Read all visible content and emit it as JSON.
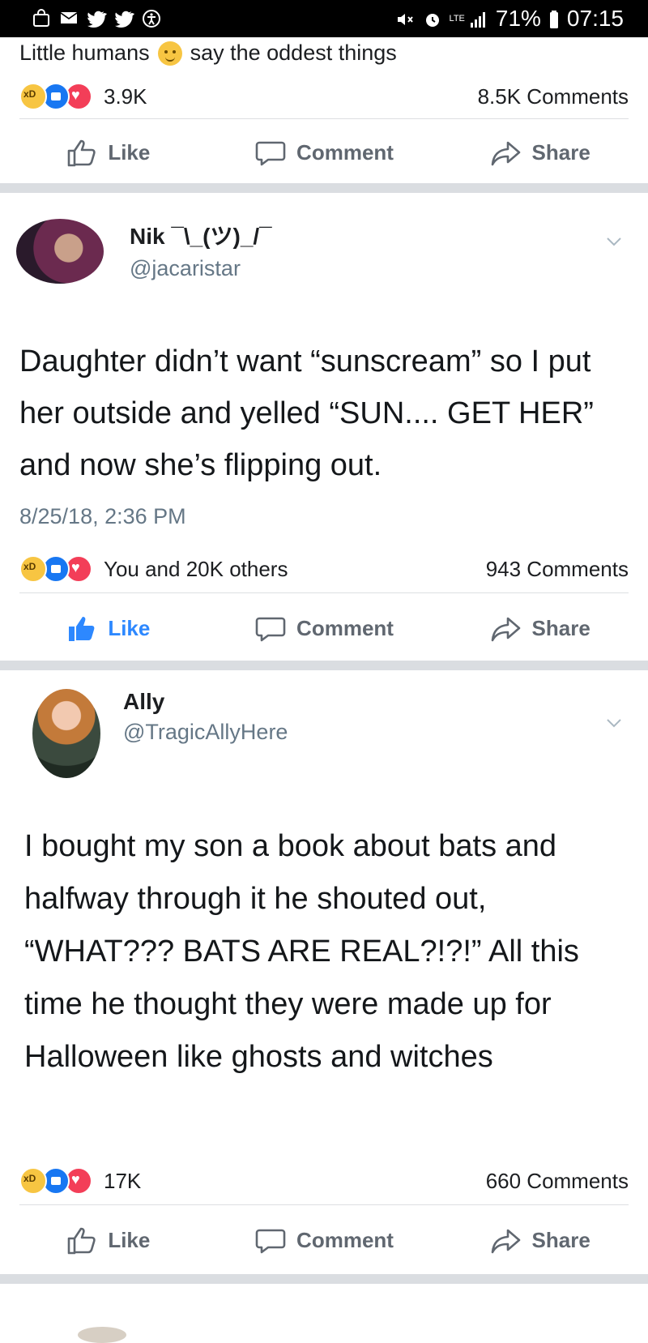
{
  "status_bar": {
    "battery": "71%",
    "time": "07:15",
    "network": "LTE",
    "left_icons": [
      "bag-icon",
      "mail-icon",
      "twitter-icon",
      "twitter-icon",
      "accessibility-icon"
    ],
    "right_icons": [
      "mute-icon",
      "alarm-icon",
      "signal-icon",
      "battery-icon"
    ]
  },
  "caption": {
    "part1": "Little humans",
    "emoji": "baby-emoji",
    "part2": "say the oddest things"
  },
  "post0": {
    "reactions_count": "3.9K",
    "comments": "8.5K Comments"
  },
  "post1": {
    "name": "Nik ¯\\_(ツ)_/¯",
    "handle": "@jacaristar",
    "text": "Daughter didn’t want “sunscream” so I put her outside and yelled “SUN.... GET HER” and now she’s flipping out.",
    "timestamp": "8/25/18, 2:36 PM",
    "reactions_label": "You and 20K others",
    "comments": "943 Comments"
  },
  "post2": {
    "name": "Ally",
    "handle": "@TragicAllyHere",
    "text": "I bought my son a book about bats and halfway through it he shouted out, “WHAT??? BATS ARE REAL?!?!” All this time he thought they were made up for Halloween like ghosts and witches",
    "reactions_count": "17K",
    "comments": "660 Comments"
  },
  "actions": {
    "like": "Like",
    "comment": "Comment",
    "share": "Share"
  },
  "colors": {
    "like_blue": "#2d88ff",
    "muted_gray": "#606770",
    "separator": "#dadde1"
  }
}
